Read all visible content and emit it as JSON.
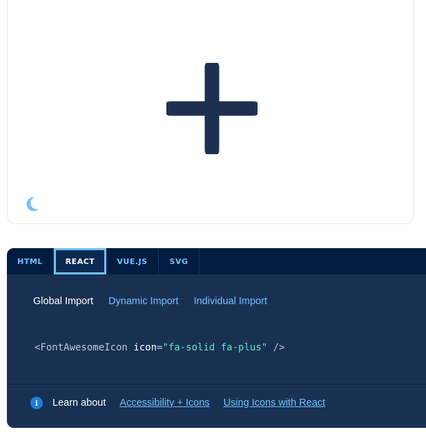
{
  "preview": {
    "icon": "plus-icon",
    "icon_color": "#1e3050",
    "theme_toggle_icon": "moon-icon",
    "theme_toggle_color": "#74c0fc"
  },
  "tabs": [
    {
      "label": "HTML"
    },
    {
      "label": "REACT"
    },
    {
      "label": "VUE.JS"
    },
    {
      "label": "SVG"
    }
  ],
  "active_tab": "REACT",
  "subtabs": [
    {
      "label": "Global Import"
    },
    {
      "label": "Dynamic Import"
    },
    {
      "label": "Individual Import"
    }
  ],
  "active_subtab": "Global Import",
  "code": {
    "open": "<FontAwesomeIcon ",
    "attr": "icon",
    "eq": "=",
    "value": "\"fa-solid fa-plus\"",
    "close": " />"
  },
  "footer": {
    "icon": "info-icon",
    "info_glyph": "i",
    "learn_label": "Learn about",
    "links": [
      {
        "label": "Accessibility + Icons"
      },
      {
        "label": "Using Icons with React"
      }
    ]
  },
  "colors": {
    "panel_bg": "#183153",
    "tab_bar_bg": "#001c40",
    "accent": "#74c0fc",
    "string_green": "#63e6be"
  }
}
